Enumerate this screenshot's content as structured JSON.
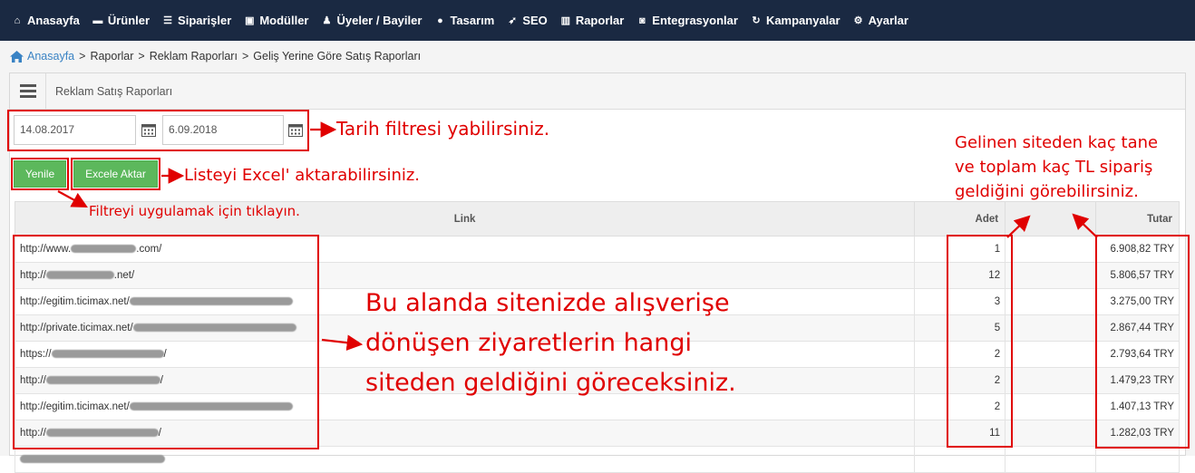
{
  "nav": {
    "items": [
      {
        "label": "Anasayfa",
        "icon": "home-icon"
      },
      {
        "label": "Ürünler",
        "icon": "folder-icon"
      },
      {
        "label": "Siparişler",
        "icon": "list-icon"
      },
      {
        "label": "Modüller",
        "icon": "box-icon"
      },
      {
        "label": "Üyeler / Bayiler",
        "icon": "users-icon"
      },
      {
        "label": "Tasarım",
        "icon": "palette-icon"
      },
      {
        "label": "SEO",
        "icon": "rocket-icon"
      },
      {
        "label": "Raporlar",
        "icon": "chart-icon"
      },
      {
        "label": "Entegrasyonlar",
        "icon": "puzzle-icon"
      },
      {
        "label": "Kampanyalar",
        "icon": "refresh-icon"
      },
      {
        "label": "Ayarlar",
        "icon": "gear-icon"
      }
    ]
  },
  "breadcrumb": {
    "home": "Anasayfa",
    "items": [
      "Raporlar",
      "Reklam Raporları",
      "Geliş Yerine Göre Satış Raporları"
    ]
  },
  "panel": {
    "title": "Reklam Satış Raporları"
  },
  "filters": {
    "start_date": "14.08.2017",
    "end_date": "6.09.2018"
  },
  "buttons": {
    "refresh": "Yenile",
    "excel": "Excele Aktar"
  },
  "table": {
    "headers": {
      "link": "Link",
      "adet": "Adet",
      "tutar": "Tutar"
    },
    "rows": [
      {
        "link": "http://www.",
        "suffix": ".com/",
        "adet": "1",
        "tutar": "6.908,82 TRY"
      },
      {
        "link": "http://",
        "suffix": ".net/",
        "adet": "12",
        "tutar": "5.806,57 TRY"
      },
      {
        "link": "http://egitim.ticimax.net/",
        "suffix": "",
        "adet": "3",
        "tutar": "3.275,00 TRY"
      },
      {
        "link": "http://private.ticimax.net/",
        "suffix": "",
        "adet": "5",
        "tutar": "2.867,44 TRY"
      },
      {
        "link": "https://",
        "suffix": "/",
        "adet": "2",
        "tutar": "2.793,64 TRY"
      },
      {
        "link": "http://",
        "suffix": "/",
        "adet": "2",
        "tutar": "1.479,23 TRY"
      },
      {
        "link": "http://egitim.ticimax.net/",
        "suffix": "",
        "adet": "2",
        "tutar": "1.407,13 TRY"
      },
      {
        "link": "http://",
        "suffix": "/",
        "adet": "11",
        "tutar": "1.282,03 TRY"
      }
    ]
  },
  "annotations": {
    "date_filter": "Tarih filtresi yabilirsiniz.",
    "excel": "Listeyi Excel' aktarabilirsiniz.",
    "refresh": "Filtreyi uygulamak için tıklayın.",
    "totals": [
      "Gelinen siteden kaç tane",
      "ve toplam kaç TL sipariş",
      "geldiğini görebilirsiniz."
    ],
    "links": [
      "Bu alanda sitenizde alışverişe",
      "dönüşen ziyaretlerin hangi",
      "siteden geldiğini göreceksiniz."
    ]
  },
  "colors": {
    "nav_bg": "#1a2942",
    "button": "#5cb85c",
    "annotation": "#e00000",
    "link": "#3a83c4"
  }
}
